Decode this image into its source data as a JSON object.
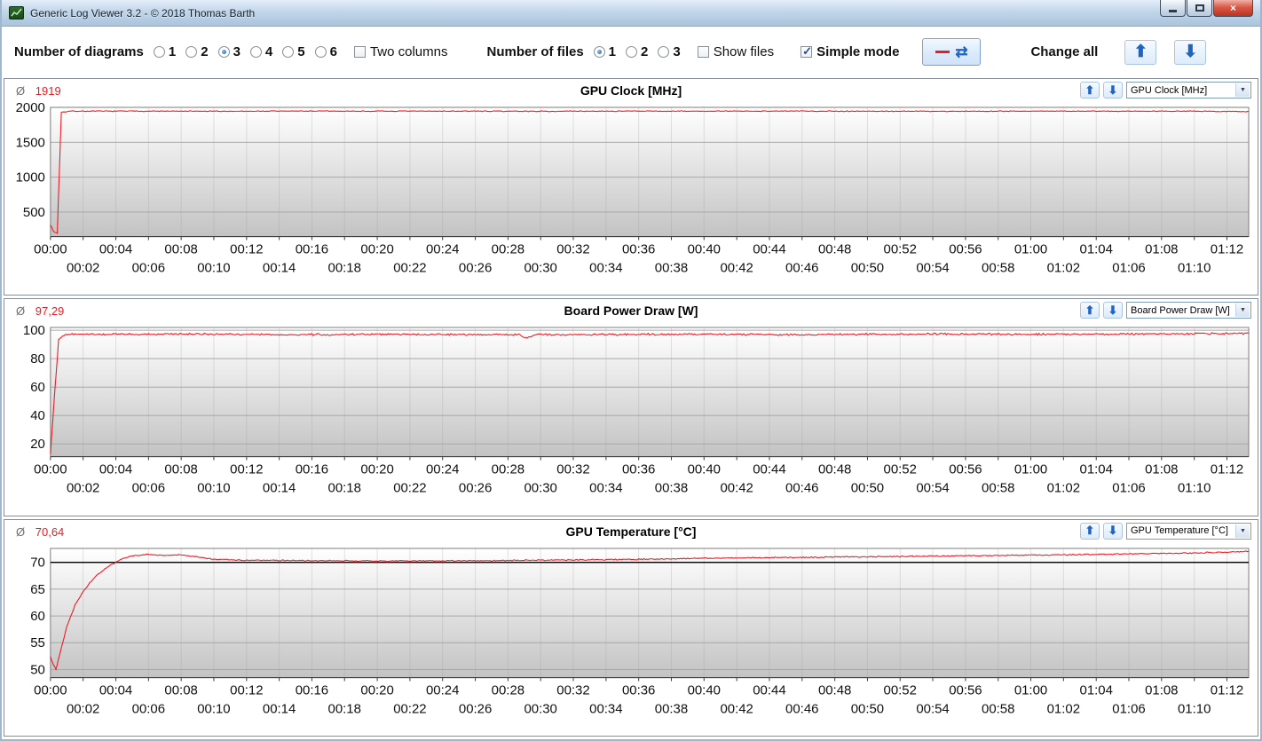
{
  "window": {
    "title": "Generic Log Viewer 3.2 - © 2018 Thomas Barth"
  },
  "icons": {
    "up_arrow": "⬆",
    "down_arrow": "⬇",
    "dropdown_arrow": "▼",
    "refresh": "⇄",
    "close": "×",
    "average_symbol": "Ø"
  },
  "toolbar": {
    "diagrams_label": "Number of diagrams",
    "diagram_options": [
      "1",
      "2",
      "3",
      "4",
      "5",
      "6"
    ],
    "diagrams_selected": "3",
    "two_columns_label": "Two columns",
    "two_columns_checked": false,
    "files_label": "Number of files",
    "file_options": [
      "1",
      "2",
      "3"
    ],
    "files_selected": "1",
    "show_files_label": "Show files",
    "show_files_checked": false,
    "simple_mode_label": "Simple mode",
    "simple_mode_checked": true,
    "change_all_label": "Change all"
  },
  "chart_data": [
    {
      "type": "line",
      "title": "GPU Clock [MHz]",
      "average_label": "Ø",
      "average_value": "1919",
      "combo_value": "GPU Clock [MHz]",
      "line_color": "#ed1c24",
      "grid": true,
      "ylim": [
        150,
        2000
      ],
      "y_ticks": [
        500,
        1000,
        1500,
        2000
      ],
      "x_max_s": 4400,
      "x_tick_step_s": 120,
      "x_tick_end_s": 4320,
      "x_format": "hh:mm",
      "noise_amp": 7,
      "points_s_v": [
        [
          0,
          320
        ],
        [
          12,
          215
        ],
        [
          25,
          200
        ],
        [
          40,
          1930
        ],
        [
          70,
          1945
        ],
        [
          300,
          1946
        ],
        [
          600,
          1944
        ],
        [
          900,
          1947
        ],
        [
          1200,
          1945
        ],
        [
          1500,
          1946
        ],
        [
          1800,
          1944
        ],
        [
          2100,
          1946
        ],
        [
          2400,
          1945
        ],
        [
          2700,
          1947
        ],
        [
          3000,
          1945
        ],
        [
          3300,
          1944
        ],
        [
          3600,
          1946
        ],
        [
          3900,
          1945
        ],
        [
          4100,
          1947
        ],
        [
          4250,
          1943
        ],
        [
          4400,
          1941
        ]
      ]
    },
    {
      "type": "line",
      "title": "Board Power Draw [W]",
      "average_label": "Ø",
      "average_value": "97,29",
      "combo_value": "Board Power Draw [W]",
      "line_color": "#ed1c24",
      "grid": true,
      "ylim": [
        11,
        102
      ],
      "y_ticks": [
        20,
        40,
        60,
        80,
        100
      ],
      "x_max_s": 4400,
      "x_tick_step_s": 120,
      "x_tick_end_s": 4320,
      "x_format": "hh:mm",
      "noise_amp": 0.8,
      "points_s_v": [
        [
          0,
          13
        ],
        [
          15,
          55
        ],
        [
          30,
          93
        ],
        [
          50,
          96.5
        ],
        [
          80,
          97.3
        ],
        [
          300,
          97.1
        ],
        [
          600,
          97.4
        ],
        [
          900,
          96.9
        ],
        [
          1200,
          97.2
        ],
        [
          1500,
          97.0
        ],
        [
          1720,
          96.8
        ],
        [
          1750,
          94.3
        ],
        [
          1780,
          96.9
        ],
        [
          2100,
          97.1
        ],
        [
          2400,
          97.3
        ],
        [
          2700,
          96.9
        ],
        [
          3000,
          97.2
        ],
        [
          3300,
          97.4
        ],
        [
          3600,
          97.1
        ],
        [
          3900,
          97.3
        ],
        [
          4200,
          97.6
        ],
        [
          4400,
          97.8
        ]
      ]
    },
    {
      "type": "line",
      "title": "GPU Temperature [°C]",
      "average_label": "Ø",
      "average_value": "70,64",
      "combo_value": "GPU Temperature [°C]",
      "line_color": "#ed1c24",
      "grid": true,
      "ref_line": 70,
      "ylim": [
        48.5,
        72.6
      ],
      "y_ticks": [
        50,
        55,
        60,
        65,
        70
      ],
      "x_max_s": 4400,
      "x_tick_step_s": 120,
      "x_tick_end_s": 4320,
      "x_format": "hh:mm",
      "noise_amp": 0.13,
      "points_s_v": [
        [
          0,
          52.5
        ],
        [
          10,
          51
        ],
        [
          20,
          50
        ],
        [
          40,
          54
        ],
        [
          60,
          58
        ],
        [
          90,
          62
        ],
        [
          120,
          64.5
        ],
        [
          150,
          66.5
        ],
        [
          180,
          68
        ],
        [
          210,
          69.2
        ],
        [
          240,
          70
        ],
        [
          270,
          70.8
        ],
        [
          300,
          71.2
        ],
        [
          360,
          71.5
        ],
        [
          420,
          71.3
        ],
        [
          480,
          71.4
        ],
        [
          540,
          71.0
        ],
        [
          600,
          70.6
        ],
        [
          700,
          70.4
        ],
        [
          800,
          70.35
        ],
        [
          1000,
          70.3
        ],
        [
          1300,
          70.25
        ],
        [
          1600,
          70.3
        ],
        [
          1900,
          70.45
        ],
        [
          2200,
          70.6
        ],
        [
          2500,
          70.8
        ],
        [
          2800,
          70.95
        ],
        [
          3100,
          71.1
        ],
        [
          3400,
          71.25
        ],
        [
          3700,
          71.4
        ],
        [
          4000,
          71.6
        ],
        [
          4200,
          71.75
        ],
        [
          4400,
          72.0
        ]
      ]
    }
  ]
}
